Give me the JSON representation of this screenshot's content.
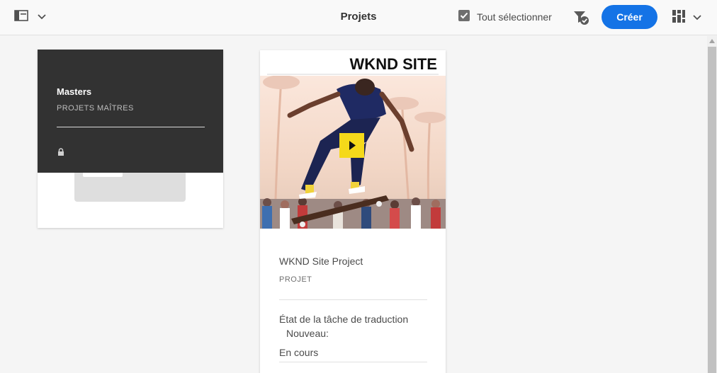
{
  "header": {
    "title": "Projets",
    "select_all_label": "Tout sélectionner",
    "create_label": "Créer"
  },
  "icons": {
    "rail_toggle": "rail-toggle-icon",
    "chevron": "chevron-down-icon",
    "select_all": "checkbox-checked-icon",
    "filter": "filter-icon",
    "view": "view-switcher-icon",
    "lock": "lock-icon",
    "play": "play-icon"
  },
  "cards": [
    {
      "title": "Masters",
      "subtitle": "PROJETS MAÎTRES",
      "locked": true
    },
    {
      "thumbnail_brand": "WKND SITE",
      "title": "WKND Site Project",
      "type": "PROJET",
      "status_label": "État de la tâche de traduction",
      "status_new": "Nouveau:",
      "status_value": "En cours"
    }
  ],
  "colors": {
    "accent": "#1473e6",
    "overlay": "#323232",
    "play_button": "#f5d91a",
    "background": "#f5f5f5"
  }
}
